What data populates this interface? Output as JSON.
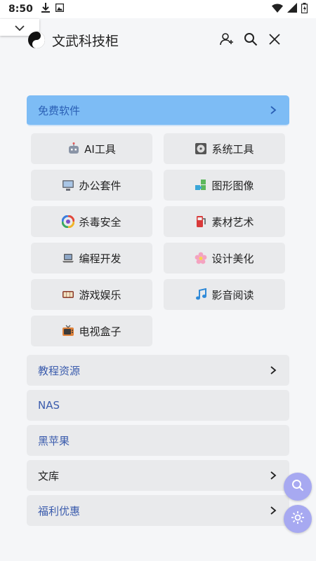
{
  "status": {
    "time": "8:50"
  },
  "header": {
    "title": "文武科技柜"
  },
  "menu": {
    "free_software": "免费软件",
    "grid": [
      {
        "label": "AI工具",
        "icon": "robot-icon"
      },
      {
        "label": "系统工具",
        "icon": "disk-icon"
      },
      {
        "label": "办公套件",
        "icon": "monitor-icon"
      },
      {
        "label": "图形图像",
        "icon": "puzzle-icon"
      },
      {
        "label": "杀毒安全",
        "icon": "shield-ring-icon"
      },
      {
        "label": "素材艺术",
        "icon": "fuel-icon"
      },
      {
        "label": "编程开发",
        "icon": "laptop-icon"
      },
      {
        "label": "设计美化",
        "icon": "flower-icon"
      },
      {
        "label": "游戏娱乐",
        "icon": "game-icon"
      },
      {
        "label": "影音阅读",
        "icon": "music-note-icon"
      },
      {
        "label": "电视盒子",
        "icon": "tv-icon"
      }
    ],
    "tutorials": "教程资源",
    "nas": "NAS",
    "hackintosh": "黑苹果",
    "library": "文库",
    "deals": "福利优惠"
  },
  "colors": {
    "active_bg": "#7dbcf5",
    "item_bg": "#e9eaec",
    "fab": "#a7a9f1",
    "link_blue": "#3b5cad"
  }
}
